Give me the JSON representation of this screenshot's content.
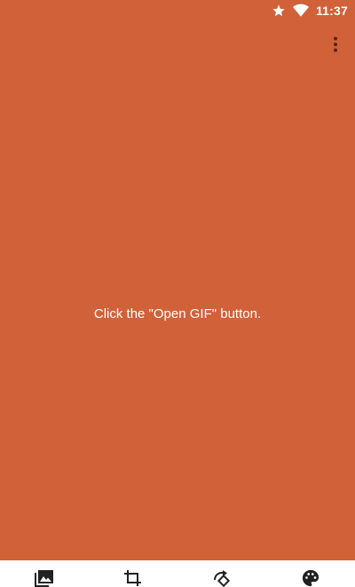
{
  "status_bar": {
    "time": "11:37",
    "icons": [
      "star-icon",
      "wifi-icon"
    ]
  },
  "app_bar": {
    "overflow_icon": "more-vert-icon"
  },
  "main": {
    "message": "Click the \"Open GIF\" button."
  },
  "toolbar": {
    "items": [
      {
        "icon": "image-library-icon"
      },
      {
        "icon": "crop-icon"
      },
      {
        "icon": "rotate-icon"
      },
      {
        "icon": "palette-icon"
      }
    ]
  },
  "colors": {
    "background": "#D06138",
    "toolbar_background": "#FFFFFF",
    "text": "#FFFFFF",
    "icon_dark": "#212121"
  }
}
